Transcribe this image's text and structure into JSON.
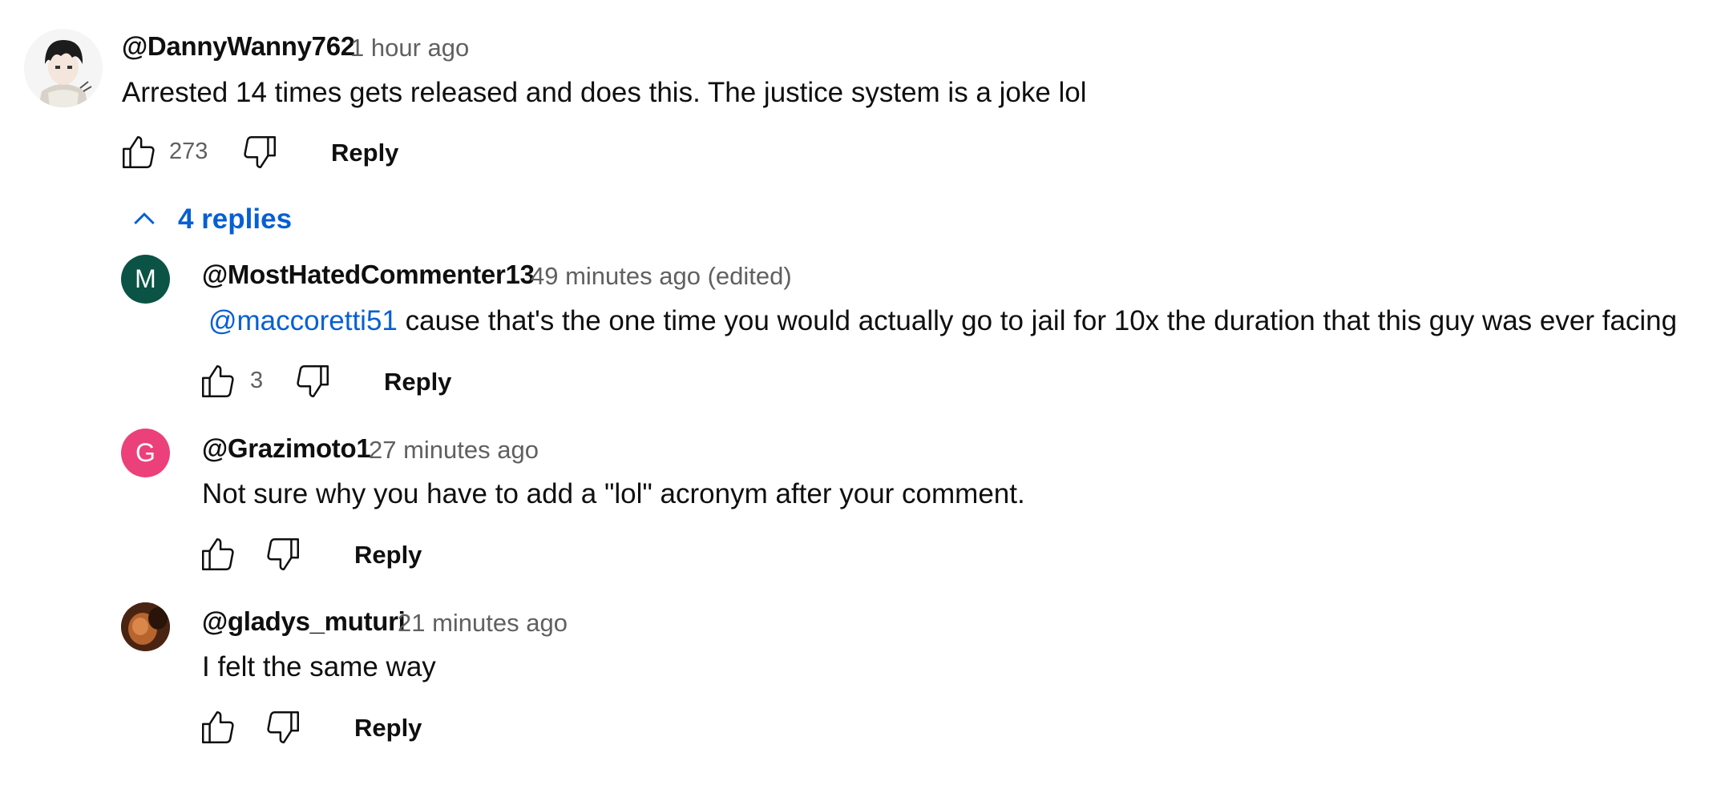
{
  "comment": {
    "author": "@DannyWanny762",
    "timestamp": "1 hour ago",
    "text": "Arrested 14 times gets released and does this. The justice system is a joke lol",
    "likes": "273",
    "reply_label": "Reply",
    "avatar_icon": "anime-character-avatar"
  },
  "replies_toggle": {
    "label": "4 replies",
    "icon": "chevron-up-icon",
    "color": "#065fd4"
  },
  "replies": [
    {
      "author": "@MostHatedCommenter13",
      "timestamp": "49 minutes ago (edited)",
      "mention": "@maccoretti51",
      "text": " cause that's the one time you would actually go to jail for 10x the duration that this guy was ever facing",
      "likes": "3",
      "reply_label": "Reply",
      "avatar_letter": "M",
      "avatar_color": "#0b5345"
    },
    {
      "author": "@Grazimoto1",
      "timestamp": "27 minutes ago",
      "text": "Not sure why you have to add a \"lol\" acronym after your comment.",
      "reply_label": "Reply",
      "avatar_letter": "G",
      "avatar_color": "#ec407a"
    },
    {
      "author": "@gladys_muturi",
      "timestamp": "21 minutes ago",
      "text": "I felt the same way",
      "reply_label": "Reply",
      "avatar_icon": "photo-avatar"
    }
  ]
}
